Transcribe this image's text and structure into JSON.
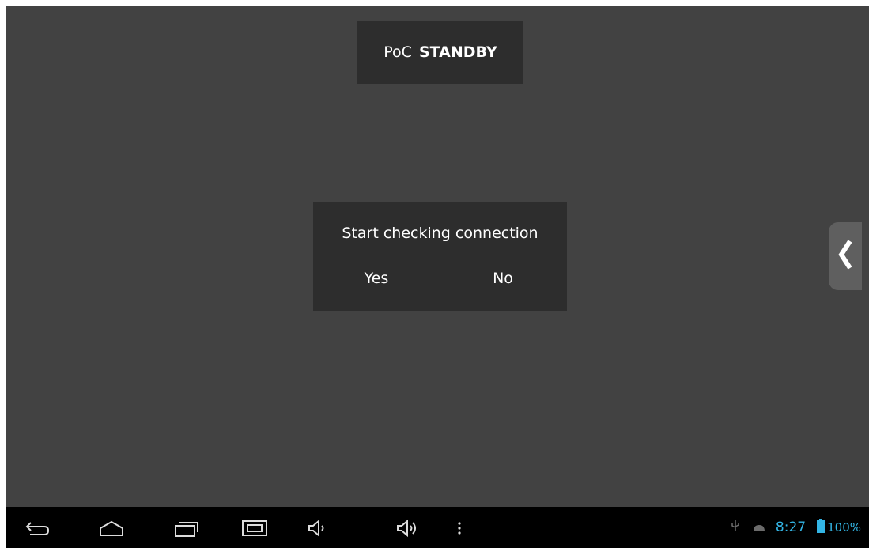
{
  "header": {
    "prefix": "PoC",
    "state": "STANDBY"
  },
  "dialog": {
    "message": "Start checking connection",
    "yes_label": "Yes",
    "no_label": "No"
  },
  "side_tab": {
    "icon": "chevron-left-icon"
  },
  "navbar": {
    "icons": [
      "back-icon",
      "home-icon",
      "recent-apps-icon",
      "screenshot-icon",
      "volume-down-icon",
      "volume-up-icon",
      "menu-icon"
    ]
  },
  "status_bar": {
    "time": "8:27",
    "battery": "100%",
    "accent_color": "#33b5e5"
  },
  "colors": {
    "background": "#424242",
    "panel": "#2d2d2d",
    "navbar": "#000000"
  }
}
